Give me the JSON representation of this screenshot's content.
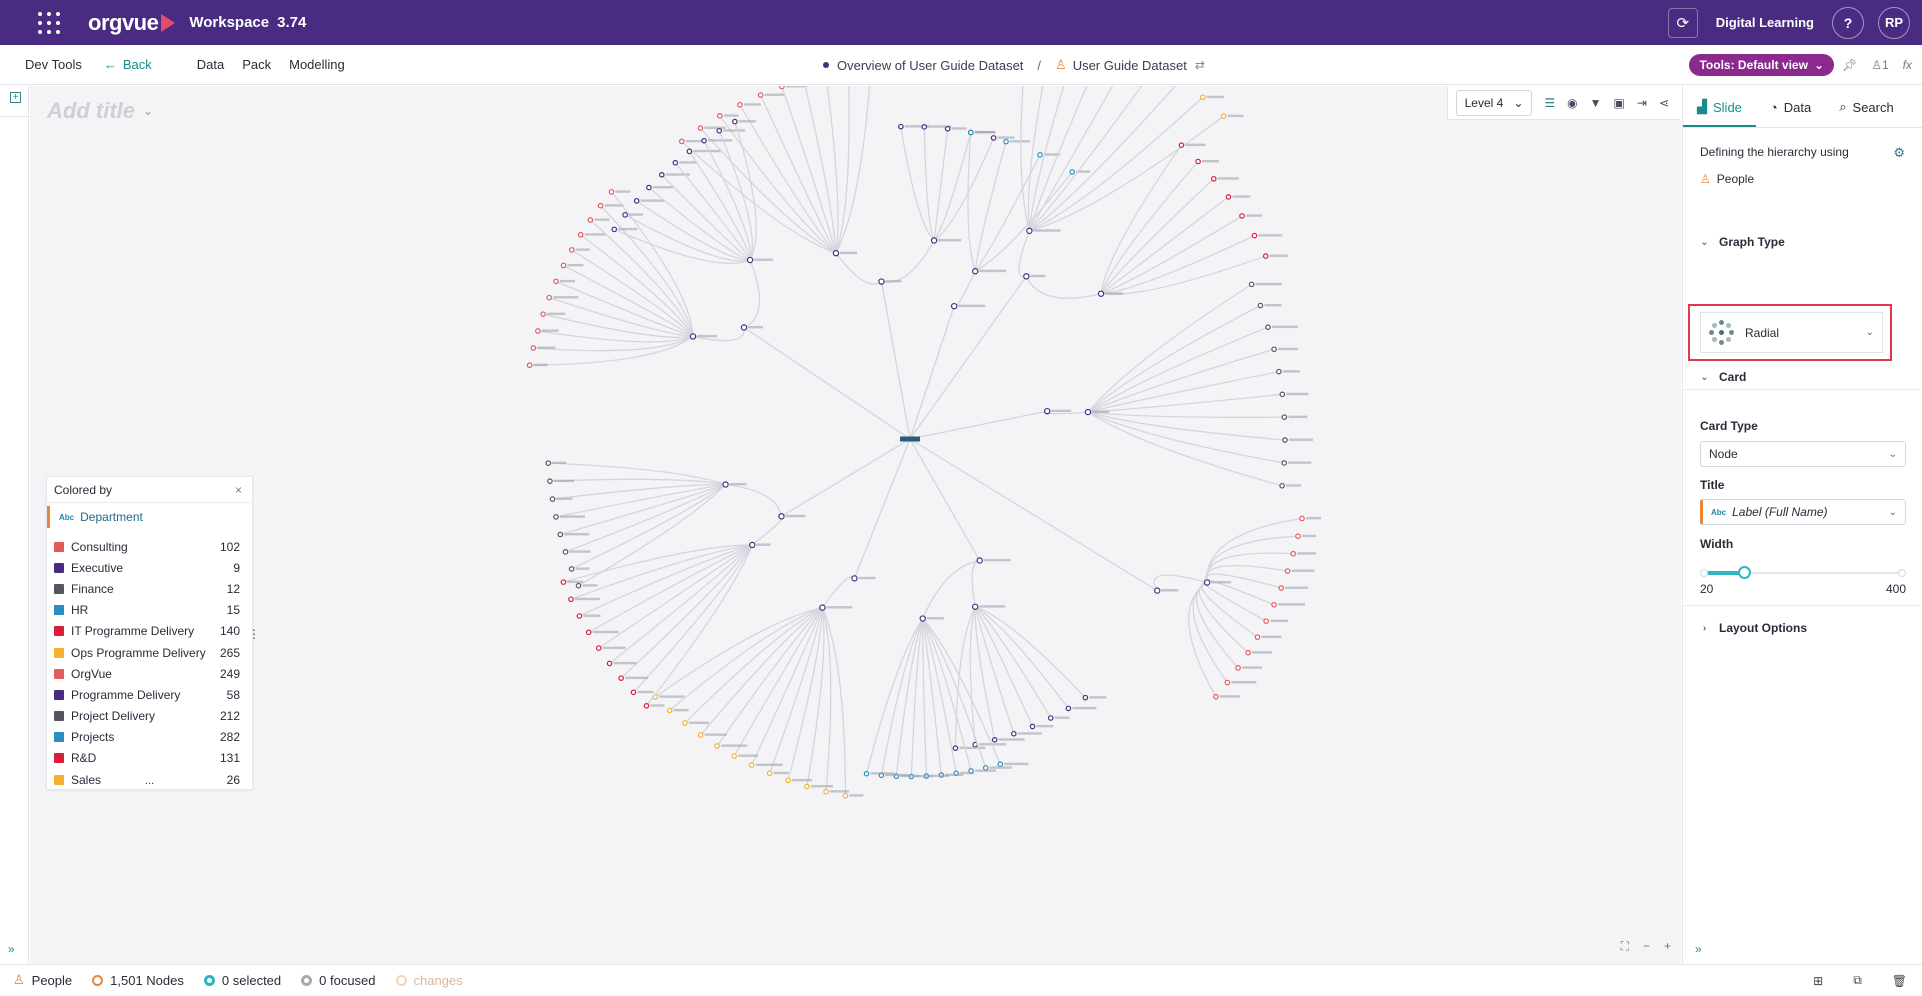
{
  "app": {
    "logo_text": "orgvue",
    "workspace_label": "Workspace",
    "version": "3.74",
    "digital_learning": "Digital Learning",
    "help": "?",
    "user_initials": "RP"
  },
  "nav": {
    "dev_tools": "Dev Tools",
    "back": "Back",
    "data": "Data",
    "pack": "Pack",
    "modelling": "Modelling",
    "breadcrumb_1": "Overview of User Guide Dataset",
    "breadcrumb_sep": "/",
    "breadcrumb_2": "User Guide Dataset",
    "tools_button": "Tools: Default view",
    "pin_count": "1",
    "fx": "fx"
  },
  "canvas": {
    "title_placeholder": "Add title",
    "level_select": "Level 4"
  },
  "legend": {
    "header": "Colored by",
    "close": "×",
    "field": "Department",
    "field_type": "Abc",
    "more": "...",
    "items": [
      {
        "label": "Consulting",
        "count": "102",
        "color": "#e05a5a"
      },
      {
        "label": "Executive",
        "count": "9",
        "color": "#4a2b82"
      },
      {
        "label": "Finance",
        "count": "12",
        "color": "#55555f"
      },
      {
        "label": "HR",
        "count": "15",
        "color": "#2b8ec1"
      },
      {
        "label": "IT Programme Delivery",
        "count": "140",
        "color": "#d81c3c"
      },
      {
        "label": "Ops Programme Delivery",
        "count": "265",
        "color": "#f2b230"
      },
      {
        "label": "OrgVue",
        "count": "249",
        "color": "#e25d5d"
      },
      {
        "label": "Programme Delivery",
        "count": "58",
        "color": "#4a2b82"
      },
      {
        "label": "Project Delivery",
        "count": "212",
        "color": "#55555f"
      },
      {
        "label": "Projects",
        "count": "282",
        "color": "#2b8ec1"
      },
      {
        "label": "R&D",
        "count": "131",
        "color": "#d81c3c"
      },
      {
        "label": "Sales",
        "count": "26",
        "color": "#f2b230"
      }
    ]
  },
  "panel": {
    "tab_slide": "Slide",
    "tab_data": "Data",
    "tab_search": "Search",
    "hierarchy_text": "Defining the hierarchy using",
    "hierarchy_dimension": "People",
    "graph_type_header": "Graph Type",
    "graph_type_value": "Radial",
    "card_header": "Card",
    "card_type_label": "Card Type",
    "card_type_value": "Node",
    "title_label": "Title",
    "title_type": "Abc",
    "title_value": "Label (Full Name)",
    "width_label": "Width",
    "width_min": "20",
    "width_max": "400",
    "width_value_fraction": 0.2,
    "layout_options": "Layout Options"
  },
  "status": {
    "dimension": "People",
    "nodes": "1,501 Nodes",
    "selected": "0 selected",
    "focused": "0 focused",
    "changes": "changes"
  }
}
